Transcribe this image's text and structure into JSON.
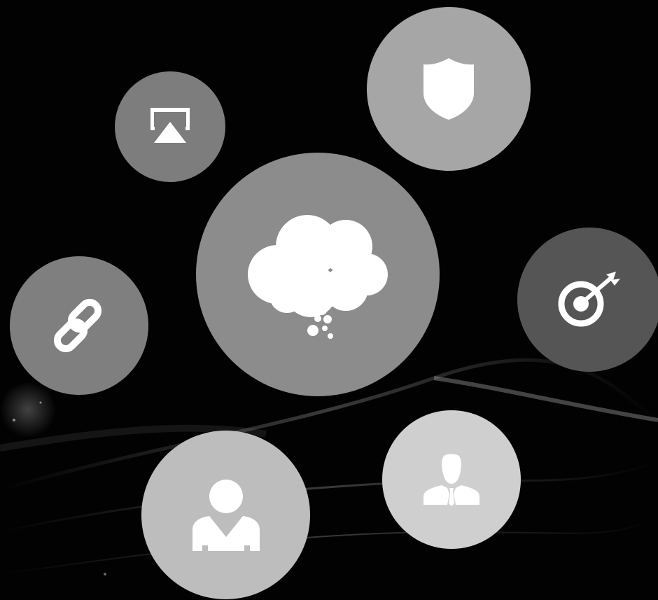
{
  "colors": {
    "background": "#020202",
    "icon": "#ffffff"
  },
  "bubbles": [
    {
      "id": "cloud",
      "icon": "thought-cloud-icon",
      "fill": "#8c8c8c"
    },
    {
      "id": "airplay",
      "icon": "airplay-icon",
      "fill": "#7d7d7d"
    },
    {
      "id": "shield",
      "icon": "shield-icon",
      "fill": "#a6a6a6"
    },
    {
      "id": "target",
      "icon": "target-arrow-icon",
      "fill": "#555555"
    },
    {
      "id": "link",
      "icon": "chain-link-icon",
      "fill": "#7f7f7f"
    },
    {
      "id": "user",
      "icon": "user-icon",
      "fill": "#bdbdbd"
    },
    {
      "id": "business",
      "icon": "businessman-icon",
      "fill": "#cfcfcf"
    }
  ]
}
